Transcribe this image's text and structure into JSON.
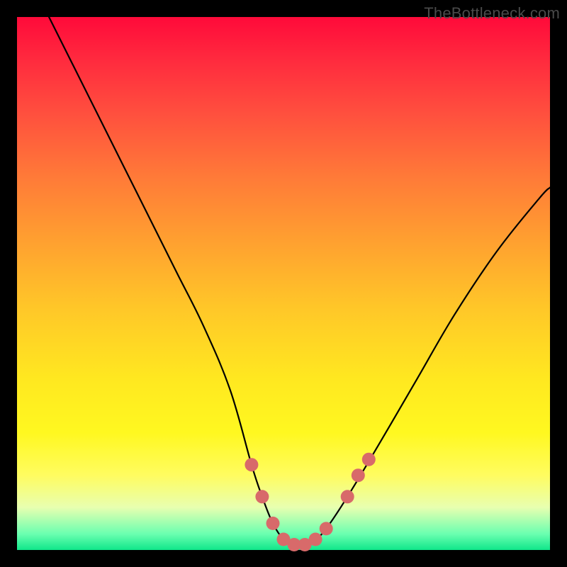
{
  "watermark": "TheBottleneck.com",
  "chart_data": {
    "type": "line",
    "title": "",
    "xlabel": "",
    "ylabel": "",
    "xlim": [
      0,
      100
    ],
    "ylim": [
      0,
      100
    ],
    "series": [
      {
        "name": "bottleneck-curve",
        "x": [
          6,
          10,
          15,
          20,
          25,
          30,
          35,
          40,
          44,
          46,
          48,
          50,
          52,
          54,
          56,
          58,
          62,
          68,
          75,
          82,
          90,
          98,
          100
        ],
        "y": [
          100,
          92,
          82,
          72,
          62,
          52,
          42,
          30,
          16,
          10,
          5,
          2,
          1,
          1,
          2,
          4,
          10,
          20,
          32,
          44,
          56,
          66,
          68
        ]
      }
    ],
    "markers": {
      "name": "highlight-dots",
      "color": "#d86a6a",
      "points": [
        {
          "x": 44,
          "y": 16
        },
        {
          "x": 46,
          "y": 10
        },
        {
          "x": 48,
          "y": 5
        },
        {
          "x": 50,
          "y": 2
        },
        {
          "x": 52,
          "y": 1
        },
        {
          "x": 54,
          "y": 1
        },
        {
          "x": 56,
          "y": 2
        },
        {
          "x": 58,
          "y": 4
        },
        {
          "x": 62,
          "y": 10
        },
        {
          "x": 64,
          "y": 14
        },
        {
          "x": 66,
          "y": 17
        }
      ]
    }
  }
}
